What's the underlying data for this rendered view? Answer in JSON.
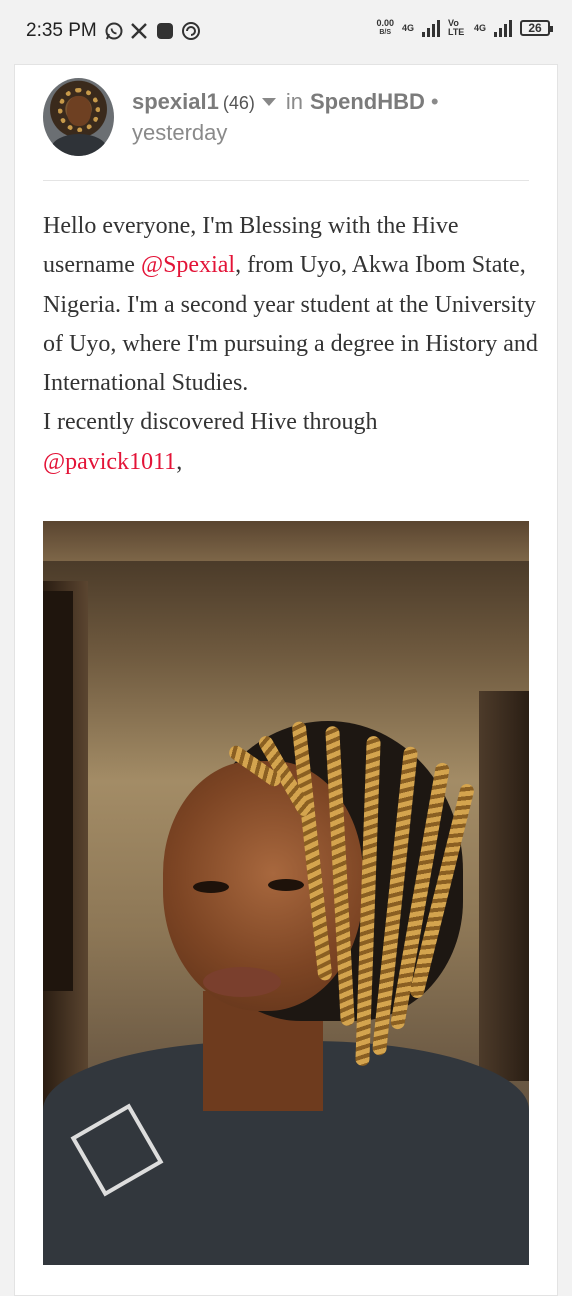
{
  "status_bar": {
    "time": "2:35 PM",
    "net_speed": "0.00",
    "net_unit": "B/S",
    "sim1": "4G",
    "volte": "Vo LTE",
    "sim2": "4G",
    "battery": "26",
    "icons": [
      "whatsapp-icon",
      "x-icon",
      "app-icon",
      "sync-icon"
    ]
  },
  "post": {
    "author": "spexial1",
    "reputation": "(46)",
    "in_label": "in",
    "community": "SpendHBD",
    "separator": "•",
    "time": "yesterday",
    "body": {
      "p1_a": "Hello everyone, I'm Blessing with the Hive username ",
      "mention1": "@Spexial",
      "p1_b": ", from Uyo, Akwa Ibom State, Nigeria. I'm a second year student at the University of Uyo, where I'm pursuing a degree in History and International Studies.",
      "p2_a": "I recently discovered Hive through ",
      "mention2": "@pavick1011",
      "p2_b": ","
    }
  }
}
